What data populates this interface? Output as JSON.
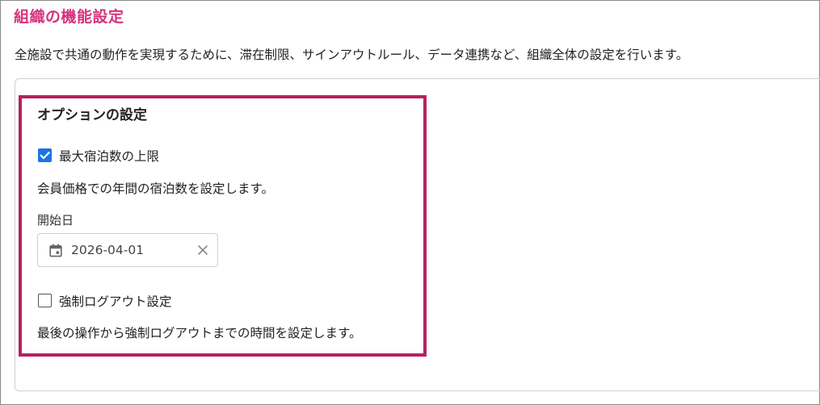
{
  "page": {
    "title": "組織の機能設定",
    "description": "全施設で共通の動作を実現するために、滞在制限、サインアウトルール、データ連携など、組織全体の設定を行います。"
  },
  "options": {
    "title": "オプションの設定",
    "max_nights": {
      "label": "最大宿泊数の上限",
      "checked": true,
      "help": "会員価格での年間の宿泊数を設定します。",
      "start_date_label": "開始日",
      "start_date_value": "2026-04-01"
    },
    "forced_logout": {
      "label": "強制ログアウト設定",
      "checked": false,
      "help": "最後の操作から強制ログアウトまでの時間を設定します。"
    }
  },
  "colors": {
    "title_pink": "#d5337e",
    "highlight_border": "#b5225e",
    "checkbox_blue": "#1a73e8"
  },
  "icons": {
    "checkbox_checked": "check-icon",
    "date_field": "calendar-icon",
    "date_clear": "close-icon"
  }
}
